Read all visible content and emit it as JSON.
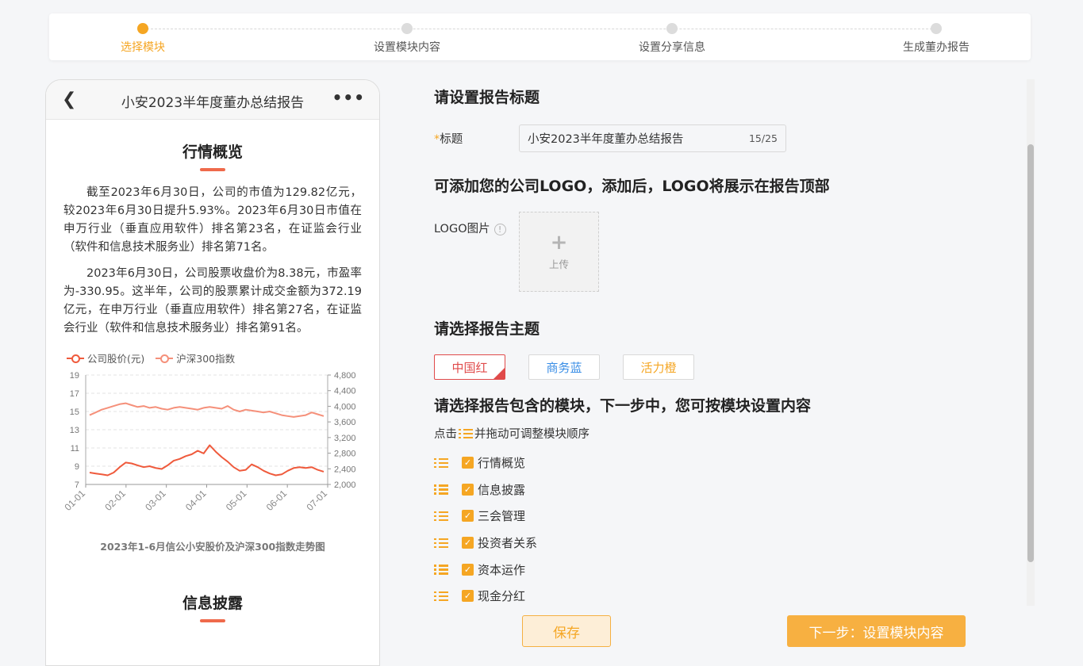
{
  "steps": [
    {
      "label": "选择模块",
      "active": true
    },
    {
      "label": "设置模块内容",
      "active": false
    },
    {
      "label": "设置分享信息",
      "active": false
    },
    {
      "label": "生成董办报告",
      "active": false
    }
  ],
  "preview": {
    "title": "小安2023半年度董办总结报告",
    "section1_title": "行情概览",
    "para1": "截至2023年6月30日，公司的市值为129.82亿元，较2023年6月30日提升5.93%。2023年6月30日市值在申万行业（垂直应用软件）排名第23名，在证监会行业（软件和信息技术服务业）排名第71名。",
    "para2": "2023年6月30日，公司股票收盘价为8.38元，市盈率为-330.95。这半年，公司的股票累计成交金额为372.19亿元，在申万行业（垂直应用软件）排名第27名，在证监会行业（软件和信息技术服务业）排名第91名。",
    "chart_caption": "2023年1-6月信公小安股价及沪深300指数走势图",
    "section2_title": "信息披露"
  },
  "chart_data": {
    "type": "line",
    "x_ticks": [
      "01-01",
      "02-01",
      "03-01",
      "04-01",
      "05-01",
      "06-01",
      "07-01"
    ],
    "y_left_ticks": [
      7,
      9,
      11,
      13,
      15,
      17,
      19
    ],
    "y_right_ticks": [
      "2,000",
      "2,400",
      "2,800",
      "3,200",
      "3,600",
      "4,000",
      "4,400",
      "4,800"
    ],
    "ylim_left": [
      7,
      19
    ],
    "ylim_right": [
      2000,
      4800
    ],
    "grid": true,
    "legend_position": "top-left",
    "series": [
      {
        "name": "公司股价(元)",
        "axis": "left",
        "color": "#ef5a3c",
        "values": [
          8.3,
          8.2,
          8.1,
          8.0,
          8.3,
          8.9,
          9.4,
          9.3,
          9.1,
          8.9,
          9.0,
          8.8,
          8.7,
          9.1,
          9.6,
          9.8,
          10.1,
          10.3,
          10.7,
          10.4,
          11.3,
          10.6,
          10.0,
          9.5,
          8.9,
          8.5,
          8.6,
          9.2,
          8.9,
          8.5,
          8.2,
          8.0,
          8.1,
          8.5,
          8.8,
          8.9,
          8.8,
          8.9,
          8.6,
          8.4
        ]
      },
      {
        "name": "沪深300指数",
        "axis": "left",
        "color": "#f5907a",
        "values": [
          14.6,
          14.9,
          15.2,
          15.4,
          15.6,
          15.8,
          15.9,
          15.7,
          15.5,
          15.6,
          15.4,
          15.5,
          15.3,
          15.2,
          15.4,
          15.5,
          15.4,
          15.3,
          15.2,
          15.4,
          15.5,
          15.4,
          15.3,
          15.6,
          15.2,
          15.0,
          15.2,
          15.1,
          15.0,
          14.9,
          15.0,
          14.8,
          14.6,
          14.5,
          14.4,
          14.5,
          14.6,
          14.9,
          14.7,
          14.5
        ]
      }
    ]
  },
  "form": {
    "h_title": "请设置报告标题",
    "title_label": "标题",
    "title_required": "*",
    "title_value": "小安2023半年度董办总结报告",
    "title_count": "15/25",
    "h_logo": "可添加您的公司LOGO，添加后，LOGO将展示在报告顶部",
    "logo_label": "LOGO图片",
    "info_icon": "!",
    "upload_plus": "+",
    "upload_label": "上传",
    "h_theme": "请选择报告主题",
    "themes": [
      {
        "label": "中国红",
        "color": "#e04a4a",
        "selected": true
      },
      {
        "label": "商务蓝",
        "color": "#3a8ee6",
        "selected": false
      },
      {
        "label": "活力橙",
        "color": "#f5a623",
        "selected": false
      }
    ],
    "h_modules": "请选择报告包含的模块，下一步中，您可按模块设置内容",
    "hint_prefix": "点击",
    "hint_suffix": "并拖动可调整模块顺序",
    "modules": [
      "行情概览",
      "信息披露",
      "三会管理",
      "投资者关系",
      "资本运作",
      "现金分红"
    ],
    "check_mark": "✓"
  },
  "buttons": {
    "save": "保存",
    "next": "下一步：设置模块内容"
  },
  "colors": {
    "accent": "#f5a623",
    "red": "#e04a4a"
  }
}
